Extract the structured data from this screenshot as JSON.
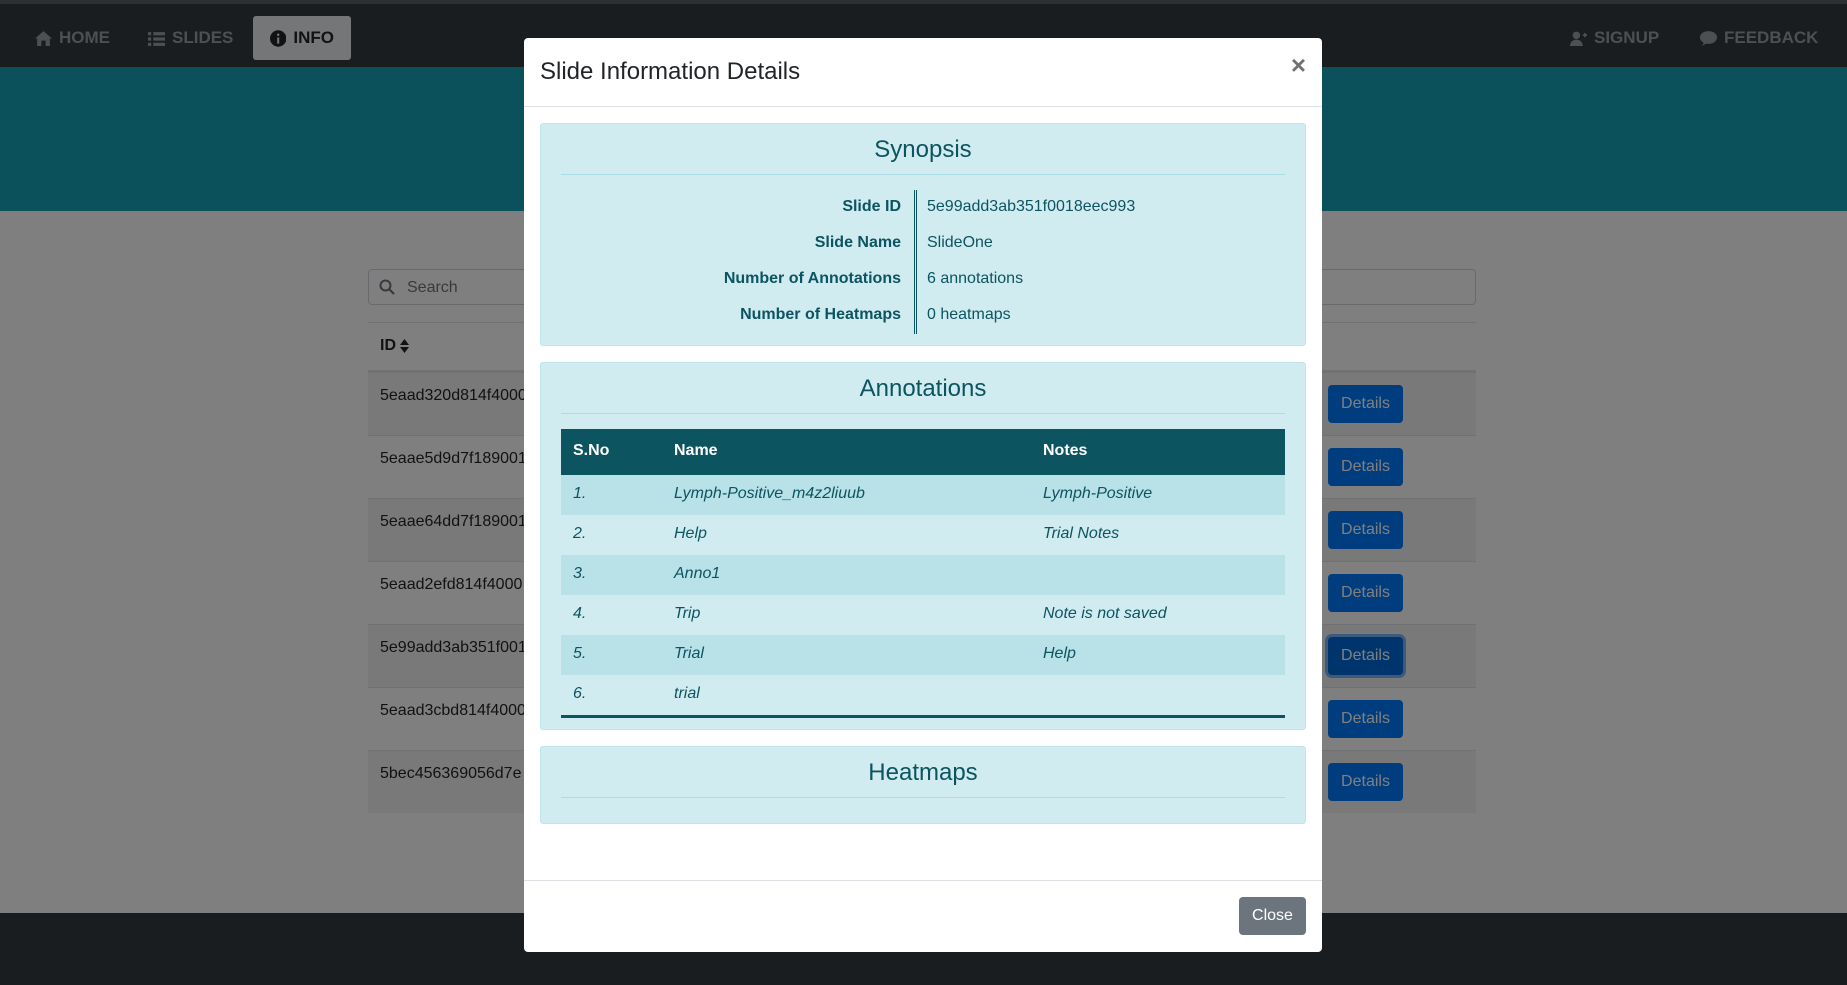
{
  "nav": {
    "home": "HOME",
    "slides": "SLIDES",
    "info": "INFO",
    "signup": "SIGNUP",
    "feedback": "FEEDBACK"
  },
  "search": {
    "placeholder": "Search"
  },
  "slides_table": {
    "id_header": "ID",
    "rows": [
      {
        "id": "5eaad320d814f4000",
        "action": "Details"
      },
      {
        "id": "5eaae5d9d7f189001",
        "action": "Details"
      },
      {
        "id": "5eaae64dd7f189001",
        "action": "Details"
      },
      {
        "id": "5eaad2efd814f4000",
        "action": "Details"
      },
      {
        "id": "5e99add3ab351f001",
        "action": "Details"
      },
      {
        "id": "5eaad3cbd814f4000",
        "action": "Details"
      },
      {
        "id": "5bec456369056d7e",
        "action": "Details"
      }
    ]
  },
  "modal": {
    "title": "Slide Information Details",
    "close_x": "×",
    "close_button": "Close",
    "synopsis": {
      "title": "Synopsis",
      "rows": [
        {
          "label": "Slide ID",
          "value": "5e99add3ab351f0018eec993"
        },
        {
          "label": "Slide Name",
          "value": "SlideOne"
        },
        {
          "label": "Number of Annotations",
          "value": "6 annotations"
        },
        {
          "label": "Number of Heatmaps",
          "value": "0 heatmaps"
        }
      ]
    },
    "annotations": {
      "title": "Annotations",
      "headers": [
        "S.No",
        "Name",
        "Notes"
      ],
      "rows": [
        {
          "sno": "1.",
          "name": "Lymph-Positive_m4z2liuub",
          "notes": "Lymph-Positive"
        },
        {
          "sno": "2.",
          "name": "Help",
          "notes": "Trial Notes"
        },
        {
          "sno": "3.",
          "name": "Anno1",
          "notes": ""
        },
        {
          "sno": "4.",
          "name": "Trip",
          "notes": "Note is not saved"
        },
        {
          "sno": "5.",
          "name": "Trial",
          "notes": "Help"
        },
        {
          "sno": "6.",
          "name": "trial",
          "notes": ""
        }
      ]
    },
    "heatmaps": {
      "title": "Heatmaps"
    }
  },
  "colors": {
    "navbar": "#343a40",
    "hero": "#17a2b8",
    "primary": "#007bff",
    "info_bg": "#d1ecf1",
    "info_text": "#0c5460",
    "secondary": "#6c757d"
  }
}
